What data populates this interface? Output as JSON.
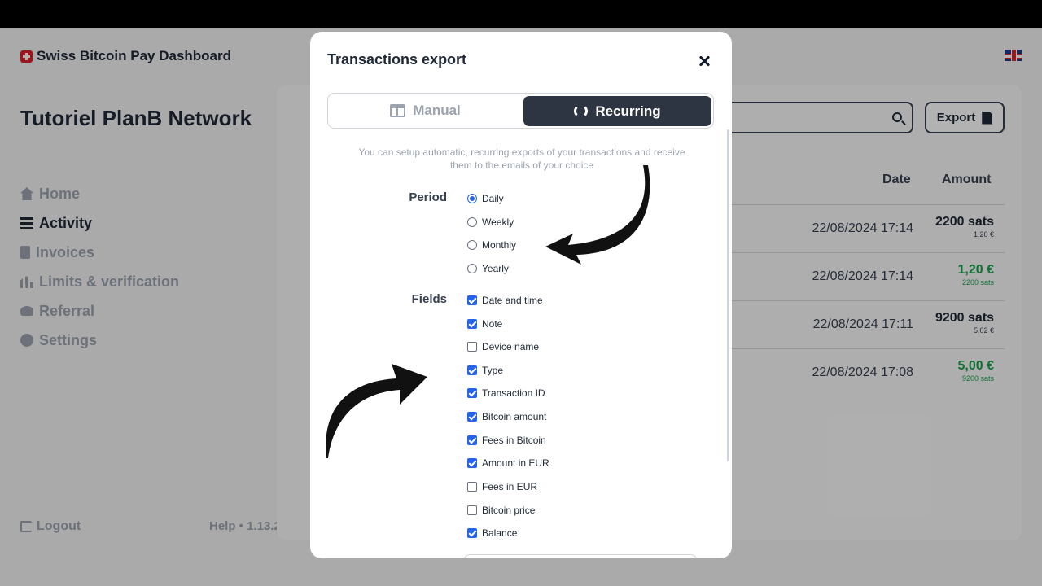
{
  "app": {
    "brand": "Swiss Bitcoin Pay Dashboard",
    "account_title": "Tutoriel PlanB Network",
    "nav": [
      {
        "label": "Home",
        "icon": "home-icon",
        "active": false
      },
      {
        "label": "Activity",
        "icon": "list-icon",
        "active": true
      },
      {
        "label": "Invoices",
        "icon": "document-icon",
        "active": false
      },
      {
        "label": "Limits & verification",
        "icon": "bar-chart-icon",
        "active": false
      },
      {
        "label": "Referral",
        "icon": "users-icon",
        "active": false
      },
      {
        "label": "Settings",
        "icon": "gear-icon",
        "active": false
      }
    ],
    "logout": "Logout",
    "help": "Help • 1.13.2",
    "export_label": "Export",
    "table": {
      "headers": {
        "date": "Date",
        "amount": "Amount"
      },
      "rows": [
        {
          "date": "22/08/2024 17:14",
          "amount": "2200 sats",
          "sub": "1,20 €",
          "incoming": false
        },
        {
          "date": "22/08/2024 17:14",
          "amount": "1,20 €",
          "sub": "2200 sats",
          "incoming": true
        },
        {
          "date": "22/08/2024 17:11",
          "amount": "9200 sats",
          "sub": "5,02 €",
          "incoming": false
        },
        {
          "date": "22/08/2024 17:08",
          "amount": "5,00 €",
          "sub": "9200 sats",
          "incoming": true
        }
      ]
    }
  },
  "modal": {
    "title": "Transactions export",
    "tabs": {
      "manual": "Manual",
      "recurring": "Recurring",
      "selected": "recurring"
    },
    "description": "You can setup automatic, recurring exports of your transactions and receive them to the emails of your choice",
    "period_label": "Period",
    "period_options": [
      {
        "label": "Daily",
        "checked": true
      },
      {
        "label": "Weekly",
        "checked": false
      },
      {
        "label": "Monthly",
        "checked": false
      },
      {
        "label": "Yearly",
        "checked": false
      }
    ],
    "fields_label": "Fields",
    "fields": [
      {
        "label": "Date and time",
        "checked": true
      },
      {
        "label": "Note",
        "checked": true
      },
      {
        "label": "Device name",
        "checked": false
      },
      {
        "label": "Type",
        "checked": true
      },
      {
        "label": "Transaction ID",
        "checked": true
      },
      {
        "label": "Bitcoin amount",
        "checked": true
      },
      {
        "label": "Fees in Bitcoin",
        "checked": true
      },
      {
        "label": "Amount in EUR",
        "checked": true
      },
      {
        "label": "Fees in EUR",
        "checked": false
      },
      {
        "label": "Bitcoin price",
        "checked": false
      },
      {
        "label": "Balance",
        "checked": true
      }
    ]
  },
  "colors": {
    "accent": "#2563eb",
    "dark_button": "#2d3442",
    "positive": "#16a34a"
  }
}
